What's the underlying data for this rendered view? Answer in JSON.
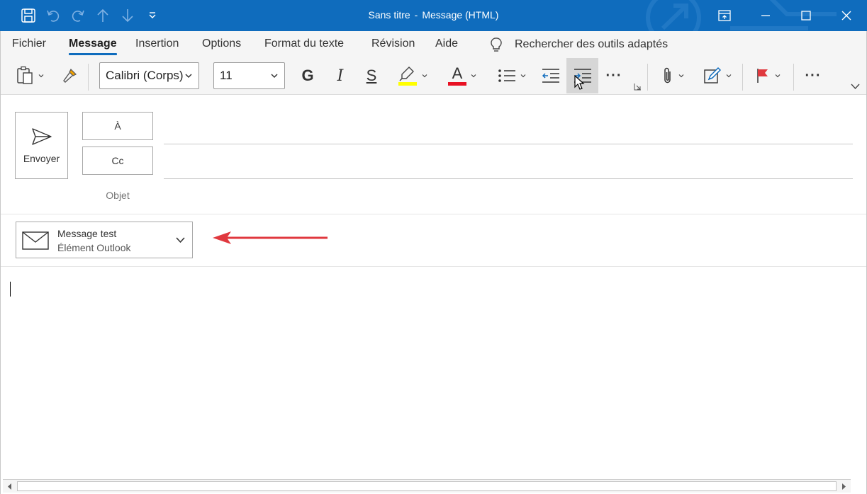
{
  "window": {
    "doc_name": "Sans titre",
    "separator": "-",
    "doc_type": "Message (HTML)",
    "titlebar_color": "#0f6cbd"
  },
  "qat": {
    "icons": [
      "save-icon",
      "undo-icon",
      "redo-icon",
      "up-arrow-icon",
      "down-arrow-icon",
      "customize-qat-icon"
    ]
  },
  "menu": {
    "tabs": [
      "Fichier",
      "Message",
      "Insertion",
      "Options",
      "Format du texte",
      "Révision",
      "Aide"
    ],
    "active": "Message",
    "search_label": "Rechercher des outils adaptés"
  },
  "ribbon": {
    "font_name": "Calibri (Corps)",
    "font_size": "11",
    "bold": "G",
    "italic": "I",
    "underline": "S",
    "font_color_glyph": "A",
    "more": "···",
    "highlight_color": "#ffff00",
    "font_color": "#e81123"
  },
  "header": {
    "send_label": "Envoyer",
    "to_label": "À",
    "cc_label": "Cc",
    "subject_label": "Objet"
  },
  "attachment": {
    "name": "Message test",
    "type": "Élément Outlook"
  },
  "annotation": {
    "arrow_color": "#e0383e"
  }
}
